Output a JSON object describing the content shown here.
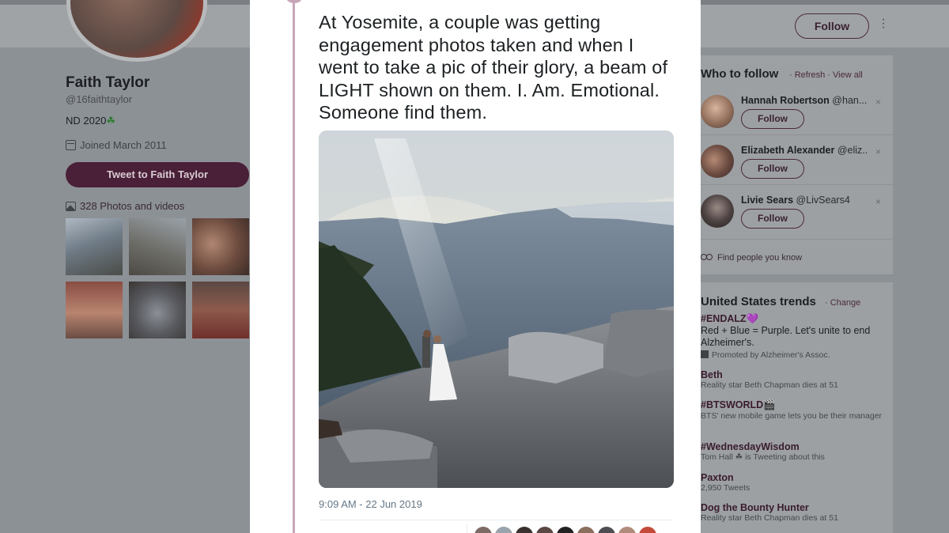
{
  "profile": {
    "name": "Faith Taylor",
    "handle": "@16faithtaylor",
    "bio": "ND 2020",
    "bio_emoji": "☘",
    "joined": "Joined March 2011",
    "tweet_to_label": "Tweet to Faith Taylor",
    "photos_label": "328 Photos and videos"
  },
  "header": {
    "follow_label": "Follow",
    "more_glyph": "⋮"
  },
  "tweet": {
    "text": "At Yosemite, a couple was getting engagement photos taken and when I went to take a pic of their glory, a beam of LIGHT shown on them. I. Am. Emotional. Someone find them.",
    "timestamp": "9:09 AM - 22 Jun 2019",
    "stats_partial": "·· ··· · ·· ···  ··· ··· ·"
  },
  "who_to_follow": {
    "title": "Who to follow",
    "links": "· Refresh · View all",
    "users": [
      {
        "name": "Hannah Robertson",
        "handle": "@han...",
        "follow_label": "Follow"
      },
      {
        "name": "Elizabeth Alexander",
        "handle": "@eliz...",
        "follow_label": "Follow"
      },
      {
        "name": "Livie Sears",
        "handle": "@LivSears4",
        "follow_label": "Follow"
      }
    ],
    "dismiss_glyph": "×",
    "find_people": "Find people you know"
  },
  "trends": {
    "title": "United States trends",
    "change_label": "· Change",
    "items": [
      {
        "name": "#ENDALZ💜",
        "desc": "Red + Blue = Purple. Let's unite to end Alzheimer's.",
        "meta": "Promoted by Alzheimer's Assoc."
      },
      {
        "name": "Beth",
        "desc": "",
        "meta": "Reality star Beth Chapman dies at 51"
      },
      {
        "name": "#BTSWORLD🎬",
        "desc": "",
        "meta": "BTS' new mobile game lets you be their manager"
      },
      {
        "name": "#WednesdayWisdom",
        "desc": "",
        "meta": "Tom Hall ☘ is Tweeting about this"
      },
      {
        "name": "Paxton",
        "desc": "",
        "meta": "2,950 Tweets"
      },
      {
        "name": "Dog the Bounty Hunter",
        "desc": "",
        "meta": "Reality star Beth Chapman dies at 51"
      }
    ]
  },
  "colors": {
    "accent": "#4a1f38",
    "backdrop": "#8c9196",
    "modal": "#ffffff",
    "thread": "#c7a6b7"
  },
  "icons": [
    "calendar-icon",
    "photo-icon",
    "people-icon",
    "close-icon",
    "more-icon",
    "promoted-icon"
  ]
}
